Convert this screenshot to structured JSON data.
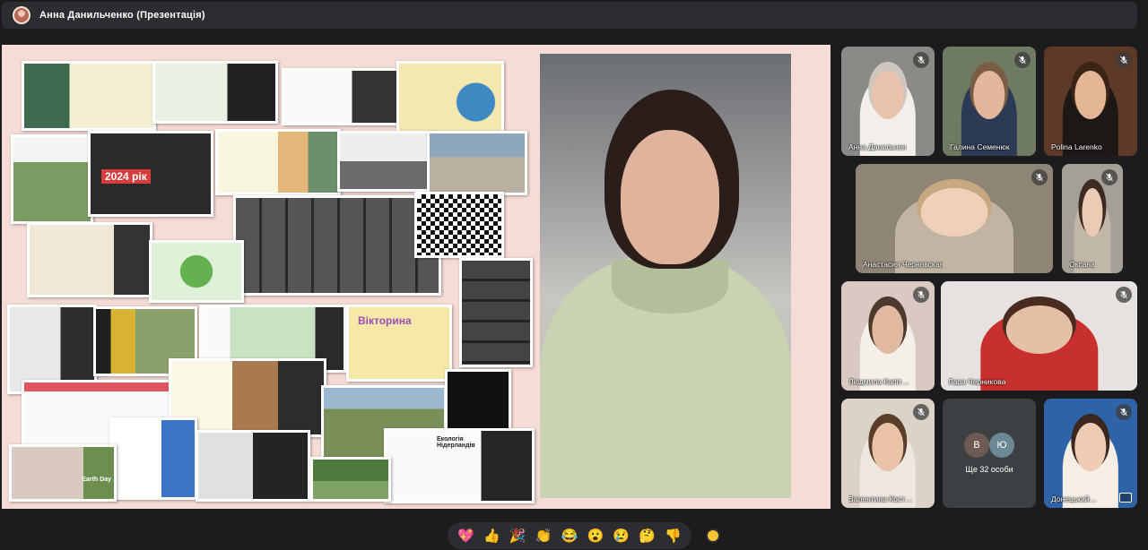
{
  "presenter": {
    "title": "Анна Данильченко (Презентація)"
  },
  "collage": {
    "slide_labels": [
      "2024 рік",
      "Вікторина",
      "Екологія Нідерландів",
      "Earth Day"
    ]
  },
  "participants": [
    {
      "name": "Анна Данильчен",
      "bg": "#8a8b87",
      "skin": "#e9c3ab",
      "shirt": "#f2eeea",
      "hair": "#cfc7bf"
    },
    {
      "name": "Галина Семенюк",
      "bg": "#6f7a63",
      "skin": "#e2b79c",
      "shirt": "#2d3a55",
      "hair": "#7a5d45"
    },
    {
      "name": "Polina Larenko",
      "bg": "#5d3a28",
      "skin": "#e5b696",
      "shirt": "#1d1715",
      "hair": "#3a2416"
    },
    {
      "name": "Анастасия Чернявская",
      "bg": "#8f8577",
      "skin": "#efd0b8",
      "shirt": "#c1b4a2",
      "hair": "#c7a881"
    },
    {
      "name": "Оксана",
      "bg": "#a49f97",
      "skin": "#eccbb4",
      "shirt": "#c1b7a8",
      "hair": "#3b2b22"
    },
    {
      "name": "Людмила Капіт…",
      "bg": "#d9c9c2",
      "skin": "#e0b9a0",
      "shirt": "#f4efe8",
      "hair": "#4d382c"
    },
    {
      "name": "Лара Черникова",
      "bg": "#e6e2df",
      "skin": "#e6c0a6",
      "shirt": "#c8302d",
      "hair": "#4a2b1f"
    },
    {
      "name": "Валентина Кост…",
      "bg": "#dcd3c8",
      "skin": "#e9c2a7",
      "shirt": "#eee7df",
      "hair": "#5a3d2a"
    },
    {
      "name": "Донецький…",
      "bg": "#2f63a7",
      "skin": "#efcbb4",
      "shirt": "#f4eee4",
      "hair": "#3b2620"
    }
  ],
  "more_people": {
    "avatar_1": "В",
    "avatar_2": "Ю",
    "label": "Ще 32 особи"
  },
  "reactions": [
    "💖",
    "👍",
    "🎉",
    "👏",
    "😂",
    "😮",
    "😢",
    "🤔",
    "👎"
  ],
  "icons": {
    "mic_off": "mic-off-icon",
    "present": "presenting-icon"
  }
}
